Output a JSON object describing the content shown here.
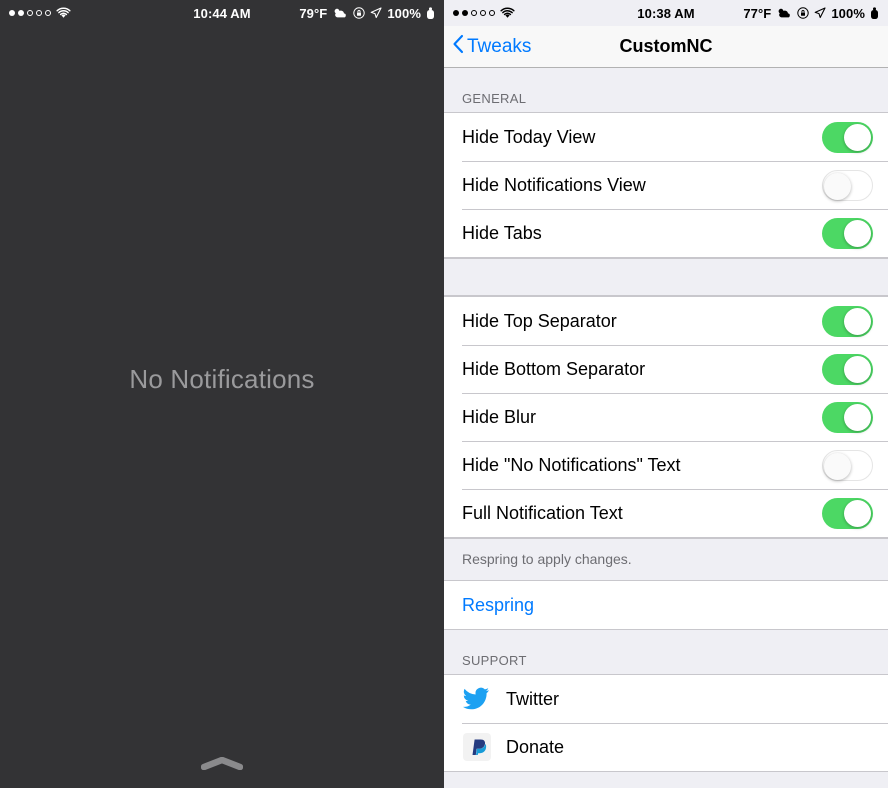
{
  "left_pane": {
    "status_bar": {
      "signal_dots": [
        "on",
        "on",
        "off",
        "off",
        "off"
      ],
      "wifi_icon": "wifi-icon",
      "time": "10:44 AM",
      "temperature": "79°F",
      "weather_icon": "partly-cloudy-icon",
      "rotation_lock_icon": "rotation-lock-icon",
      "location_icon": "location-arrow-icon",
      "battery_percent": "100%",
      "battery_icon": "battery-full-icon"
    },
    "empty_message": "No Notifications",
    "grabber": "grabber-handle"
  },
  "right_pane": {
    "status_bar": {
      "signal_dots": [
        "on",
        "on",
        "off",
        "off",
        "off"
      ],
      "wifi_icon": "wifi-icon",
      "time": "10:38 AM",
      "temperature": "77°F",
      "weather_icon": "partly-cloudy-icon",
      "rotation_lock_icon": "rotation-lock-icon",
      "location_icon": "location-arrow-icon",
      "battery_percent": "100%",
      "battery_icon": "battery-full-icon"
    },
    "navbar": {
      "back_label": "Tweaks",
      "back_icon": "chevron-left-icon",
      "title": "CustomNC"
    },
    "sections": [
      {
        "header": "GENERAL",
        "rows": [
          {
            "label": "Hide Today View",
            "toggle": "on"
          },
          {
            "label": "Hide Notifications View",
            "toggle": "off"
          },
          {
            "label": "Hide Tabs",
            "toggle": "on"
          }
        ]
      },
      {
        "header": "",
        "rows": [
          {
            "label": "Hide Top Separator",
            "toggle": "on"
          },
          {
            "label": "Hide Bottom Separator",
            "toggle": "on"
          },
          {
            "label": "Hide Blur",
            "toggle": "on"
          },
          {
            "label": "Hide \"No Notifications\" Text",
            "toggle": "off"
          },
          {
            "label": "Full Notification Text",
            "toggle": "on"
          }
        ],
        "footer": "Respring to apply changes."
      },
      {
        "header": "",
        "rows": [
          {
            "label": "Respring",
            "type": "link"
          }
        ]
      },
      {
        "header": "SUPPORT",
        "rows": [
          {
            "label": "Twitter",
            "icon": "twitter-icon"
          },
          {
            "label": "Donate",
            "icon": "paypal-icon"
          }
        ]
      }
    ]
  },
  "colors": {
    "ios_blue": "#007aff",
    "switch_green": "#4cd864",
    "nc_background": "#333335",
    "group_background": "#efeff4",
    "twitter_blue": "#1da1f2",
    "paypal_blue": "#253b80"
  }
}
